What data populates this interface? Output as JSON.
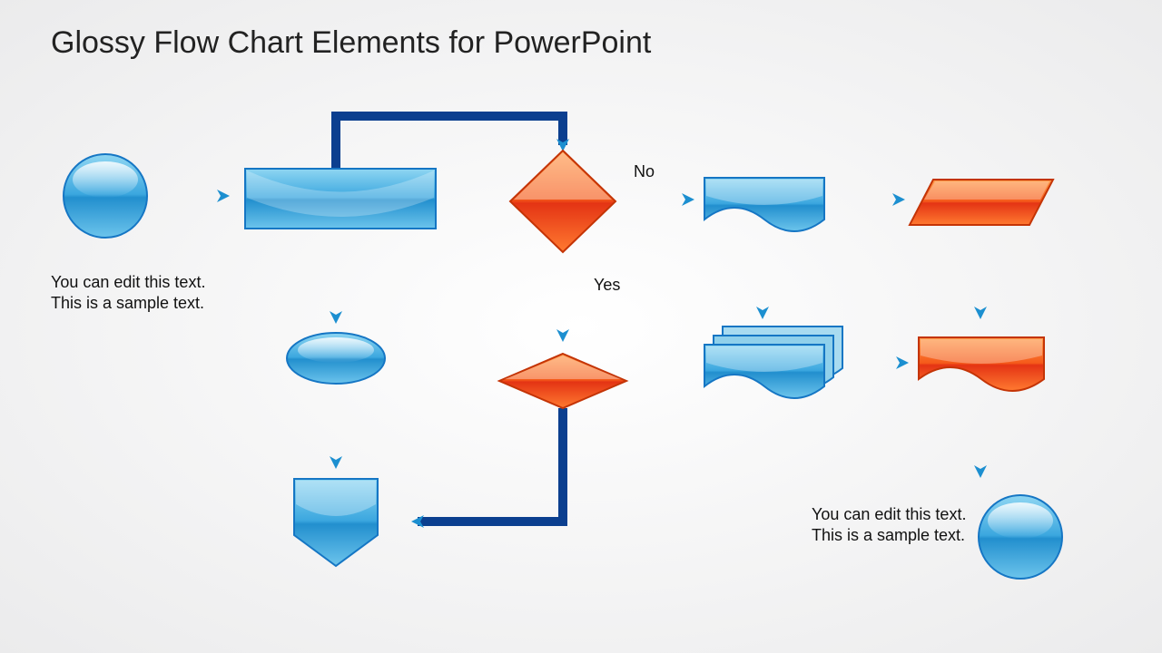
{
  "title": "Glossy Flow Chart Elements for PowerPoint",
  "labels": {
    "no": "No",
    "yes": "Yes"
  },
  "captions": {
    "left": "You can edit this text. This is a sample text.",
    "right": "You can edit this text. This is a sample text."
  },
  "colors": {
    "blue_light": "#6cc4ec",
    "blue_mid": "#2e9fdb",
    "blue_dark": "#0b3f8f",
    "arrow": "#0b3f8f",
    "arrow_tip": "#1992d2",
    "orange_light": "#ff8a3c",
    "orange_dark": "#e43414",
    "stroke_blue": "#1576c4",
    "stroke_orange": "#c43406"
  }
}
